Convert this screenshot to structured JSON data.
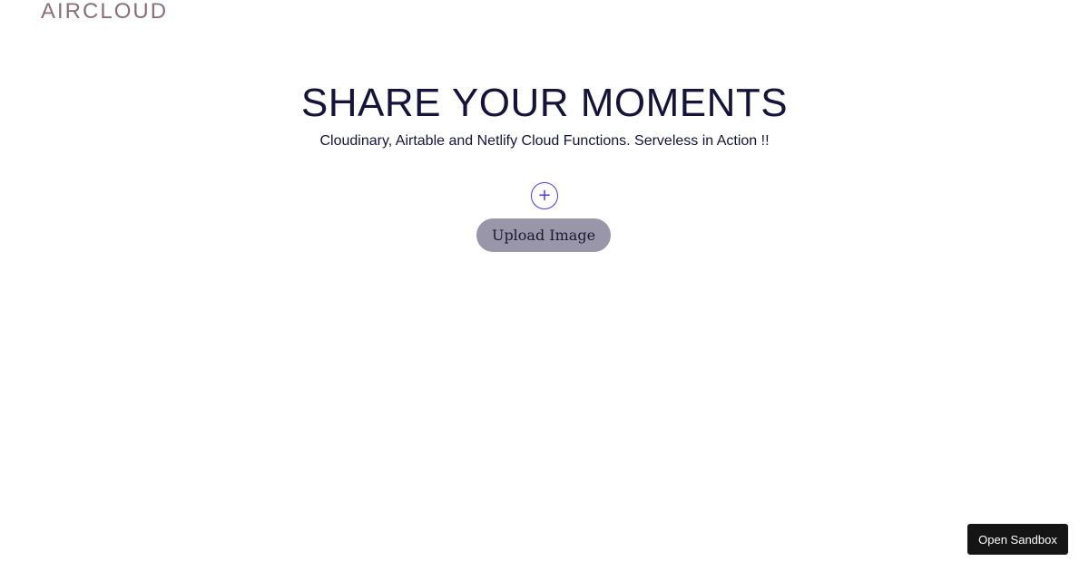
{
  "header": {
    "logo": "AIRCLOUD"
  },
  "hero": {
    "title": "SHARE YOUR MOMENTS",
    "subtitle": "Cloudinary, Airtable and Netlify Cloud Functions. Serveless in Action !!"
  },
  "upload": {
    "add_icon": "plus-icon",
    "add_glyph": "+",
    "button_label": "Upload Image"
  },
  "sandbox": {
    "label": "Open Sandbox"
  },
  "colors": {
    "logo": "#8a6e7a",
    "heading": "#16133a",
    "accent": "#4a3fd6",
    "upload_button_bg": "#9896a8",
    "sandbox_button_bg": "#151515"
  }
}
